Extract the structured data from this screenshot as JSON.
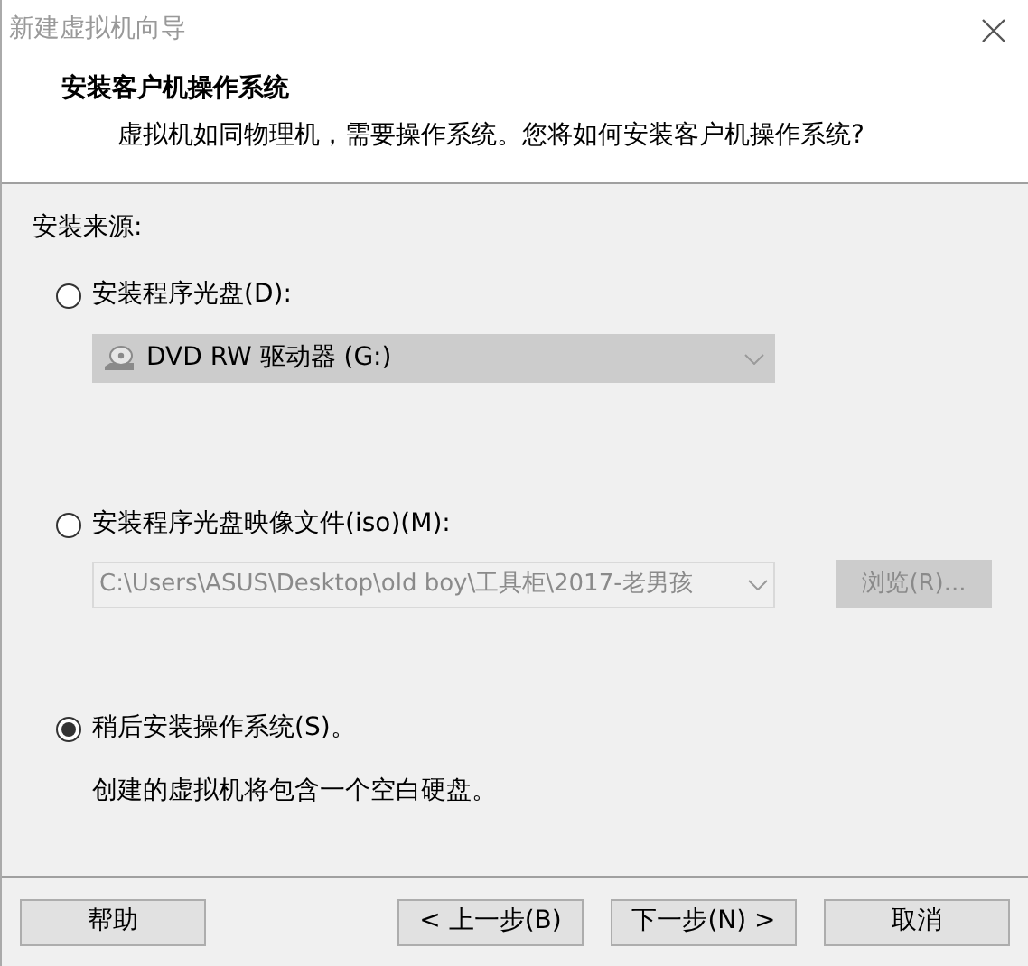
{
  "window": {
    "title": "新建虚拟机向导"
  },
  "header": {
    "title": "安装客户机操作系统",
    "subtitle": "虚拟机如同物理机，需要操作系统。您将如何安装客户机操作系统?"
  },
  "source": {
    "label": "安装来源:",
    "options": [
      {
        "kind": "drive",
        "label": "安装程序光盘(D):",
        "selected": false,
        "value": "DVD RW 驱动器 (G:)",
        "disabled": false
      },
      {
        "kind": "image",
        "label": "安装程序光盘映像文件(iso)(M):",
        "selected": false,
        "value": "C:\\Users\\ASUS\\Desktop\\old boy\\工具柜\\2017-老男孩",
        "disabled": true,
        "button": "浏览(R)..."
      },
      {
        "kind": "later",
        "label": "稍后安装操作系统(S)。",
        "selected": true,
        "note": "创建的虚拟机将包含一个空白硬盘。"
      }
    ]
  },
  "buttons": [
    "帮助",
    "< 上一步(B)",
    "下一步(N) >",
    "取消"
  ]
}
